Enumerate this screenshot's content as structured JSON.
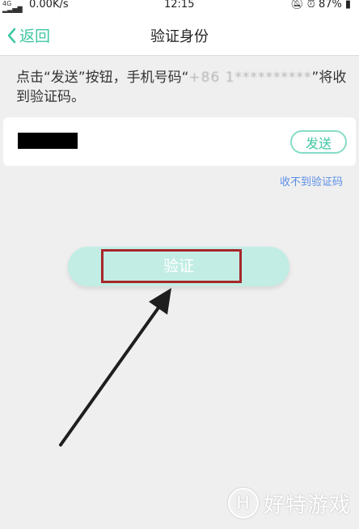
{
  "status_bar": {
    "signal": "4G",
    "network_speed": "0.00K/s",
    "time": "12:15",
    "battery": "87%",
    "icons": [
      "bell-muted-icon",
      "alarm-icon",
      "battery-icon"
    ]
  },
  "nav": {
    "back_label": "返回",
    "title": "验证身份"
  },
  "instruction": {
    "prefix": "点击“发送”按钮，手机号码“",
    "phone_masked": "+86 1**********",
    "suffix": "”将收到验证码。"
  },
  "code_row": {
    "code_value": "",
    "send_label": "发送"
  },
  "no_code_link": "收不到验证码",
  "verify_label": "验证",
  "watermark": {
    "logo_letter": "H",
    "text": "好特游戏"
  },
  "colors": {
    "accent": "#3ec7a3",
    "link": "#5b8fe6",
    "highlight": "#a6272a",
    "verify_bg": "#c2ede4"
  }
}
